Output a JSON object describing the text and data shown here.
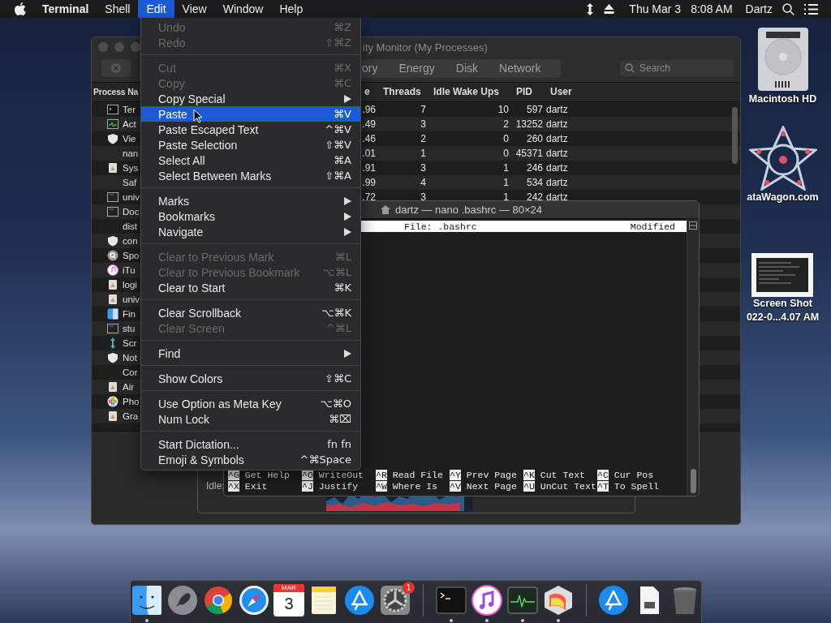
{
  "menu_bar": {
    "items": [
      {
        "label": "Terminal",
        "kind": "app",
        "selected": false
      },
      {
        "label": "Shell",
        "kind": "menu",
        "selected": false
      },
      {
        "label": "Edit",
        "kind": "menu",
        "selected": true
      },
      {
        "label": "View",
        "kind": "menu",
        "selected": false
      },
      {
        "label": "Window",
        "kind": "menu",
        "selected": false
      },
      {
        "label": "Help",
        "kind": "menu",
        "selected": false
      }
    ],
    "date": "Thu Mar 3",
    "time": "8:08 AM",
    "user": "Dartz"
  },
  "edit_menu": {
    "groups": [
      [
        {
          "label": "Undo",
          "shortcut": "⌘Z",
          "submenu": false,
          "disabled": true,
          "selected": false
        },
        {
          "label": "Redo",
          "shortcut": "⇧⌘Z",
          "submenu": false,
          "disabled": true,
          "selected": false
        }
      ],
      [
        {
          "label": "Cut",
          "shortcut": "⌘X",
          "submenu": false,
          "disabled": true,
          "selected": false
        },
        {
          "label": "Copy",
          "shortcut": "⌘C",
          "submenu": false,
          "disabled": true,
          "selected": false
        },
        {
          "label": "Copy Special",
          "submenu": true,
          "disabled": false,
          "selected": false
        },
        {
          "label": "Paste",
          "shortcut": "⌘V",
          "submenu": false,
          "disabled": false,
          "selected": true
        },
        {
          "label": "Paste Escaped Text",
          "shortcut": "^⌘V",
          "submenu": false,
          "disabled": false,
          "selected": false
        },
        {
          "label": "Paste Selection",
          "shortcut": "⇧⌘V",
          "submenu": false,
          "disabled": false,
          "selected": false
        },
        {
          "label": "Select All",
          "shortcut": "⌘A",
          "submenu": false,
          "disabled": false,
          "selected": false
        },
        {
          "label": "Select Between Marks",
          "shortcut": "⇧⌘A",
          "submenu": false,
          "disabled": false,
          "selected": false
        }
      ],
      [
        {
          "label": "Marks",
          "submenu": true,
          "disabled": false,
          "selected": false
        },
        {
          "label": "Bookmarks",
          "submenu": true,
          "disabled": false,
          "selected": false
        },
        {
          "label": "Navigate",
          "submenu": true,
          "disabled": false,
          "selected": false
        }
      ],
      [
        {
          "label": "Clear to Previous Mark",
          "shortcut": "⌘L",
          "submenu": false,
          "disabled": true,
          "selected": false
        },
        {
          "label": "Clear to Previous Bookmark",
          "shortcut": "⌥⌘L",
          "submenu": false,
          "disabled": true,
          "selected": false
        },
        {
          "label": "Clear to Start",
          "shortcut": "⌘K",
          "submenu": false,
          "disabled": false,
          "selected": false
        }
      ],
      [
        {
          "label": "Clear Scrollback",
          "shortcut": "⌥⌘K",
          "submenu": false,
          "disabled": false,
          "selected": false
        },
        {
          "label": "Clear Screen",
          "shortcut": "^⌘L",
          "submenu": false,
          "disabled": true,
          "selected": false
        }
      ],
      [
        {
          "label": "Find",
          "submenu": true,
          "disabled": false,
          "selected": false
        }
      ],
      [
        {
          "label": "Show Colors",
          "shortcut": "⇧⌘C",
          "submenu": false,
          "disabled": false,
          "selected": false
        }
      ],
      [
        {
          "label": "Use Option as Meta Key",
          "shortcut": "⌥⌘O",
          "submenu": false,
          "disabled": false,
          "selected": false
        },
        {
          "label": "Num Lock",
          "shortcut": "⌘⌧",
          "submenu": false,
          "disabled": false,
          "selected": false
        }
      ],
      [
        {
          "label": "Start Dictation...",
          "shortcut": "fn fn",
          "submenu": false,
          "disabled": false,
          "selected": false
        },
        {
          "label": "Emoji & Symbols",
          "shortcut": "^⌘Space",
          "submenu": false,
          "disabled": false,
          "selected": false
        }
      ]
    ]
  },
  "activity_monitor": {
    "title": "ity Monitor (My Processes)",
    "tabs": [
      {
        "label": "ory",
        "selected": false
      },
      {
        "label": "Energy",
        "selected": false
      },
      {
        "label": "Disk",
        "selected": false
      },
      {
        "label": "Network",
        "selected": false
      }
    ],
    "search": {
      "placeholder": "Search"
    },
    "columns": [
      "Process Na",
      "e",
      "Threads",
      "Idle Wake Ups",
      "PID",
      "User"
    ],
    "rows": [
      {
        "name": "Ter",
        "kind": "terminal",
        "column_2": ".96",
        "threads": "7",
        "idle_wake_ups": "10",
        "pid": "597",
        "user": "dartz"
      },
      {
        "name": "Act",
        "kind": "monitor",
        "column_2": ".49",
        "threads": "3",
        "idle_wake_ups": "2",
        "pid": "13252",
        "user": "dartz"
      },
      {
        "name": "Vie",
        "kind": "shield",
        "column_2": ".46",
        "threads": "2",
        "idle_wake_ups": "0",
        "pid": "260",
        "user": "dartz"
      },
      {
        "name": "nan",
        "column_2": ".01",
        "threads": "1",
        "idle_wake_ups": "0",
        "pid": "45371",
        "user": "dartz"
      },
      {
        "name": "Sys",
        "kind": "app",
        "column_2": ".91",
        "threads": "3",
        "idle_wake_ups": "1",
        "pid": "246",
        "user": "dartz"
      },
      {
        "name": "Saf",
        "column_2": ".99",
        "threads": "4",
        "idle_wake_ups": "1",
        "pid": "534",
        "user": "dartz"
      },
      {
        "name": "univ",
        "kind": "window",
        "column_2": ".72",
        "threads": "3",
        "idle_wake_ups": "1",
        "pid": "242",
        "user": "dartz"
      },
      {
        "name": "Doc",
        "kind": "window"
      },
      {
        "name": "dist"
      },
      {
        "name": "con",
        "kind": "shield"
      },
      {
        "name": "Spo",
        "kind": "search"
      },
      {
        "name": "iTu",
        "kind": "music"
      },
      {
        "name": "logi",
        "kind": "app"
      },
      {
        "name": "univ",
        "kind": "app"
      },
      {
        "name": "Fin",
        "kind": "finder"
      },
      {
        "name": "stu",
        "kind": "window"
      },
      {
        "name": "Scr",
        "kind": "arrows"
      },
      {
        "name": "Not",
        "kind": "shield"
      },
      {
        "name": "Cor"
      },
      {
        "name": "Air",
        "kind": "app"
      },
      {
        "name": "Pho",
        "kind": "photos"
      },
      {
        "name": "Gra",
        "kind": "app"
      }
    ],
    "idle_label": "Idle:"
  },
  "terminal": {
    "title": "dartz — nano .bashrc — 80×24",
    "file_label": "File: .bashrc",
    "status": "Modified",
    "shortcuts": [
      {
        "key": "^G",
        "label": "Get Help"
      },
      {
        "key": "^O",
        "label": "WriteOut"
      },
      {
        "key": "^R",
        "label": "Read File"
      },
      {
        "key": "^Y",
        "label": "Prev Page"
      },
      {
        "key": "^K",
        "label": "Cut Text"
      },
      {
        "key": "^C",
        "label": "Cur Pos"
      },
      {
        "key": "^X",
        "label": "Exit"
      },
      {
        "key": "^J",
        "label": "Justify"
      },
      {
        "key": "^W",
        "label": "Where Is"
      },
      {
        "key": "^V",
        "label": "Next Page"
      },
      {
        "key": "^U",
        "label": "UnCut Text"
      },
      {
        "key": "^T",
        "label": "To Spell"
      }
    ]
  },
  "desktop_icons": [
    {
      "kind": "drive",
      "label_lines": [
        "Macintosh HD"
      ]
    },
    {
      "kind": "web-logo",
      "label_lines": [
        "ataWagon.com"
      ]
    },
    {
      "kind": "screenshot",
      "label_lines": [
        "Screen Shot",
        "022-0...4.07 AM"
      ]
    }
  ],
  "dock": [
    {
      "kind": "finder",
      "running": true
    },
    {
      "kind": "launchpad",
      "running": false
    },
    {
      "kind": "chrome",
      "running": false
    },
    {
      "kind": "safari",
      "running": false
    },
    {
      "kind": "calendar",
      "month": "MAR",
      "day": "3",
      "running": false
    },
    {
      "kind": "notes",
      "running": false
    },
    {
      "kind": "appstore",
      "running": false
    },
    {
      "kind": "settings",
      "badge": "1",
      "running": false
    },
    {
      "kind": "separator"
    },
    {
      "kind": "terminal",
      "running": true
    },
    {
      "kind": "music",
      "running": true
    },
    {
      "kind": "monitor",
      "running": true
    },
    {
      "kind": "grapher",
      "running": true
    },
    {
      "kind": "separator"
    },
    {
      "kind": "downloads",
      "running": false
    },
    {
      "kind": "document",
      "running": false
    },
    {
      "kind": "trash",
      "running": false
    }
  ]
}
